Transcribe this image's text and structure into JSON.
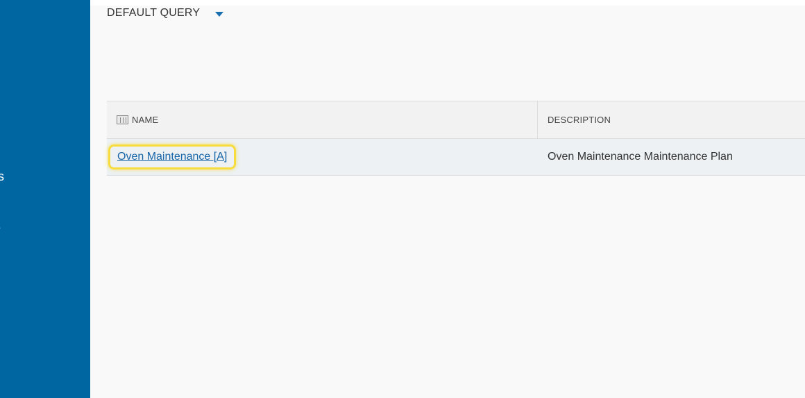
{
  "sidebar": {
    "background": "#0066a1",
    "items": [
      {
        "label": "cs"
      },
      {
        "label": "e"
      }
    ]
  },
  "query": {
    "title": "DEFAULT QUERY",
    "dropdown_icon": "caret-down-icon"
  },
  "grid": {
    "columns": [
      {
        "label": "NAME",
        "icon": "column-chooser-icon"
      },
      {
        "label": "DESCRIPTION"
      }
    ],
    "rows": [
      {
        "name": "Oven Maintenance [A]",
        "description": "Oven Maintenance Maintenance Plan"
      }
    ]
  },
  "colors": {
    "link": "#1565a8",
    "highlight": "#f7dc40"
  }
}
